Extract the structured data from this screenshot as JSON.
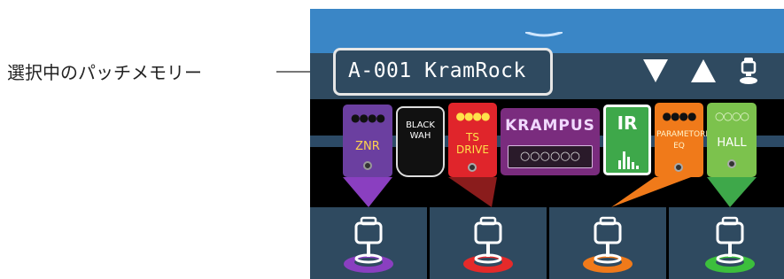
{
  "callout": {
    "label": "選択中のパッチメモリー"
  },
  "screen": {
    "patch_name": "A-001 KramRock",
    "controls": {
      "down_icon": "triangle-down",
      "up_icon": "triangle-up",
      "footswitch_icon": "footswitch"
    },
    "pedals": [
      {
        "name": "ZNR",
        "color": "#6b3fa0",
        "label_color": "#ffd34d"
      },
      {
        "name": "BLACK WAH",
        "color": "#111111",
        "label_color": "#ffffff"
      },
      {
        "name": "TS DRIVE",
        "color": "#e0252b",
        "label_color": "#ffe14a"
      },
      {
        "name": "KRAMPUS",
        "color": "#7a2c7e",
        "label_color": "#f1d9ff"
      },
      {
        "name": "IR",
        "color": "#3ea84a",
        "label_color": "#ffffff"
      },
      {
        "name": "PARAMETORIC EQ",
        "color": "#f07a1a",
        "label_color": "#fff2c8"
      },
      {
        "name": "HALL",
        "color": "#7cc24d",
        "label_color": "#ffffff"
      }
    ],
    "footswitches": [
      {
        "color": "#8a3fc0",
        "state": "on"
      },
      {
        "color": "#e52a2a",
        "state": "on"
      },
      {
        "color": "#f07a1a",
        "state": "on"
      },
      {
        "color": "#3cbf3c",
        "state": "on"
      }
    ]
  }
}
